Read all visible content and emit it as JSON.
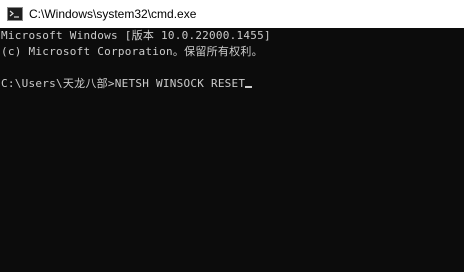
{
  "window": {
    "title": "C:\\Windows\\system32\\cmd.exe",
    "icon": "cmd-icon"
  },
  "console": {
    "lines": [
      "Microsoft Windows [版本 10.0.22000.1455]",
      "(c) Microsoft Corporation。保留所有权利。",
      "",
      "C:\\Users\\天龙八部>NETSH WINSOCK RESET"
    ]
  },
  "colors": {
    "background": "#0c0c0c",
    "foreground": "#cccccc",
    "titlebar": "#ffffff"
  }
}
